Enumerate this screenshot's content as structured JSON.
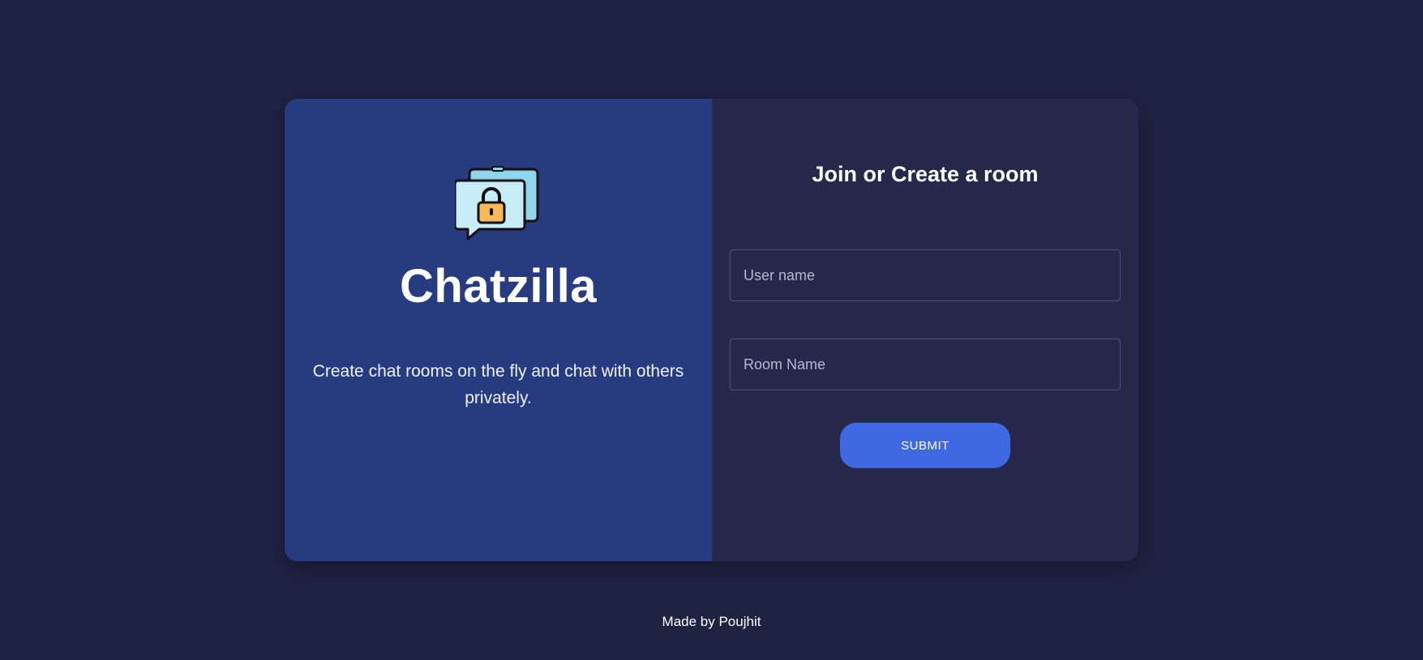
{
  "brand": {
    "name": "Chatzilla",
    "tagline": "Create chat rooms on the fly and chat with others privately.",
    "logo_icon": "chat-lock-icon"
  },
  "form": {
    "title": "Join or Create a room",
    "username_placeholder": "User name",
    "username_value": "",
    "roomname_placeholder": "Room Name",
    "roomname_value": "",
    "submit_label": "SUBMIT"
  },
  "footer": {
    "text": "Made by Poujhit"
  },
  "colors": {
    "page_background": "#1f2343",
    "left_panel": "#273b80",
    "right_panel": "#25284b",
    "accent": "#3f69e2"
  }
}
